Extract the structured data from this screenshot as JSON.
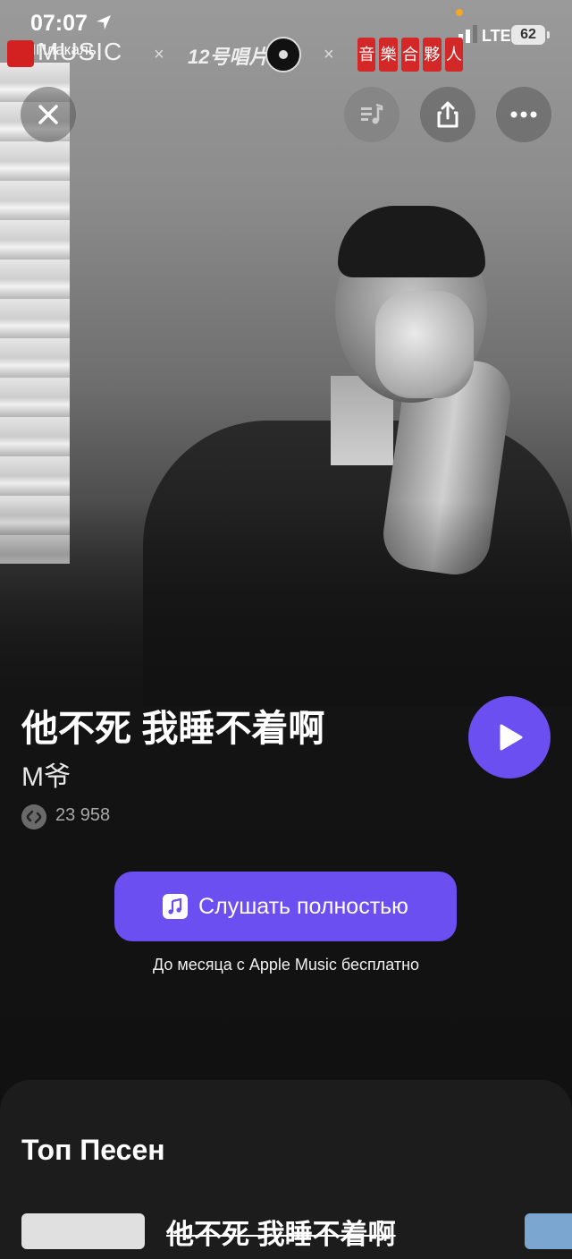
{
  "status_bar": {
    "time": "07:07",
    "back_app": "◀ ЯПлакаль",
    "network": "LTE",
    "battery": "62"
  },
  "partner_logos": {
    "logo1_text": "MUSIC",
    "separator": "×",
    "logo2_text": "12号唱片",
    "logo3_chars": [
      "音",
      "樂",
      "合",
      "夥",
      "人"
    ]
  },
  "toolbar": {
    "close_icon": "close-icon",
    "queue_icon": "music-queue-icon",
    "share_icon": "share-icon",
    "more_icon": "more-icon"
  },
  "track": {
    "title": "他不死 我睡不着啊",
    "artist": "M爷",
    "shazam_count": "23 958"
  },
  "actions": {
    "listen_label": "Слушать полностью",
    "apple_music_note": "До месяца с Apple Music бесплатно"
  },
  "top_songs": {
    "heading": "Топ Песен",
    "items": [
      {
        "title": "他不死 我睡不着啊"
      }
    ]
  },
  "colors": {
    "accent": "#6b4ff0",
    "background": "#111111",
    "card": "#1c1c1c"
  }
}
